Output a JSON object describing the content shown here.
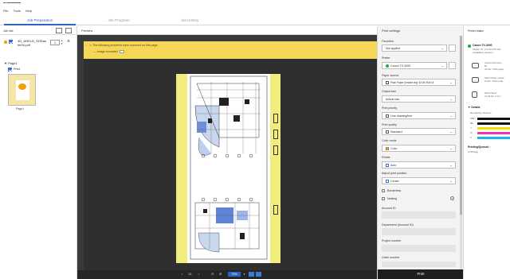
{
  "menu": {
    "file": "File",
    "tools": "Tools",
    "help": "Help"
  },
  "tabs": [
    {
      "label": "Job Preparation"
    },
    {
      "label": "Job Progress"
    },
    {
      "label": "Job History"
    }
  ],
  "job_list": {
    "title": "Job list",
    "job": {
      "name": "4D_ANSI-D_SGRaster04.pdf",
      "copies": "1"
    },
    "page_group": "Page1",
    "print_row_label": "Print",
    "page_label": "Page1"
  },
  "preview": {
    "title": "Preview",
    "warning_line1": "The following problems have occurred on this page.",
    "warning_line2": "Image truncated",
    "pager": "1/1",
    "zoom": "79%"
  },
  "settings": {
    "title": "Print settings",
    "favorites": {
      "label": "Favorites",
      "value": "Not applied"
    },
    "printer": {
      "label": "Printer",
      "value": "Canon TX-3000"
    },
    "paper_source": {
      "label": "Paper source",
      "value": "Plain Paper (Instant dry) 42.0in Roll Ui"
    },
    "output_size": {
      "label": "Output size",
      "value": "Actual size"
    },
    "print_priority": {
      "label": "Print priority",
      "value": "Line drawing/text"
    },
    "print_quality": {
      "label": "Print quality",
      "value": "Standard"
    },
    "color_mode": {
      "label": "Color mode",
      "value": "Color"
    },
    "rotate": {
      "label": "Rotate",
      "value": "Auto"
    },
    "adjust_position": {
      "label": "Adjust print position",
      "value": "Center"
    },
    "borderless": "Borderless",
    "nesting": "Nesting",
    "account_id": "Account ID",
    "department": "Department (Account ID)",
    "project_number": "Project number",
    "order_number": "Order number",
    "print_button": "Print"
  },
  "status": {
    "title": "Printer status",
    "printer_name": "Canon TX-3000",
    "target": "Target: IP: 172.20.155.104",
    "install_loc": "Installation location:",
    "paper1_a": "Canon Premium",
    "paper1_b": "Bl",
    "paper1_c": "44.0in / Roll paper",
    "paper2_a": "Plain Paper (Unde",
    "paper2_b": "Cut/In / Roll unde",
    "paper3_a": "Plain Paper",
    "paper3_b": "A4 (8.3in x 11.7",
    "details": "Details",
    "remaining_ink": "Remaining ink/toner",
    "ink_labels": [
      "MBK",
      "BK",
      "Y",
      "M",
      "C"
    ],
    "ink_colors": [
      "#111111",
      "#111111",
      "#f0e000",
      "#e23aa6",
      "#19b4e8"
    ],
    "printing_queued": "Printing/Queued :",
    "queued_value": "0 (0Page)"
  }
}
